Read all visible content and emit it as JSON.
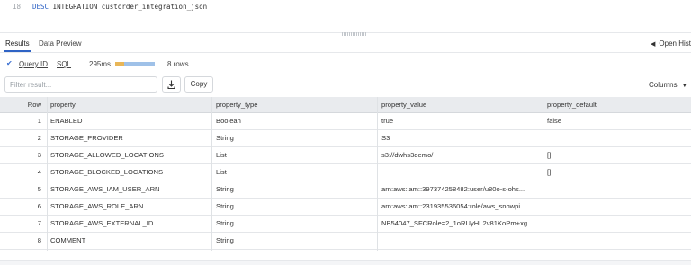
{
  "editor": {
    "line_number": "18",
    "keyword": "DESC",
    "statement": " INTEGRATION custorder_integration_json"
  },
  "tabs": [
    {
      "label": "Results",
      "active": true
    },
    {
      "label": "Data Preview",
      "active": false
    }
  ],
  "open_history": {
    "label": "Open Hist",
    "icon": "arrow-left-icon"
  },
  "query_info": {
    "status_icon": "check-icon",
    "query_id_label": "Query ID",
    "sql_label": "SQL",
    "duration": "295ms",
    "rows": "8 rows"
  },
  "toolbar": {
    "filter_placeholder": "Filter result...",
    "download_icon": "download-icon",
    "copy_label": "Copy",
    "columns_label": "Columns"
  },
  "table": {
    "columns": [
      "Row",
      "property",
      "property_type",
      "property_value",
      "property_default"
    ],
    "rows": [
      [
        "1",
        "ENABLED",
        "Boolean",
        "true",
        "false"
      ],
      [
        "2",
        "STORAGE_PROVIDER",
        "String",
        "S3",
        ""
      ],
      [
        "3",
        "STORAGE_ALLOWED_LOCATIONS",
        "List",
        "s3://dwhs3demo/",
        "[]"
      ],
      [
        "4",
        "STORAGE_BLOCKED_LOCATIONS",
        "List",
        "",
        "[]"
      ],
      [
        "5",
        "STORAGE_AWS_IAM_USER_ARN",
        "String",
        "arn:aws:iam::397374258482:user/u80o-s-ohs...",
        ""
      ],
      [
        "6",
        "STORAGE_AWS_ROLE_ARN",
        "String",
        "arn:aws:iam::231935536054:role/aws_snowpi...",
        ""
      ],
      [
        "7",
        "STORAGE_AWS_EXTERNAL_ID",
        "String",
        "NB54047_SFCRole=2_1oRUyHL2v81KoPm+xg...",
        ""
      ],
      [
        "8",
        "COMMENT",
        "String",
        "",
        ""
      ]
    ]
  },
  "colors": {
    "accent": "#2f63c5",
    "header_bg": "#e9ebee"
  }
}
